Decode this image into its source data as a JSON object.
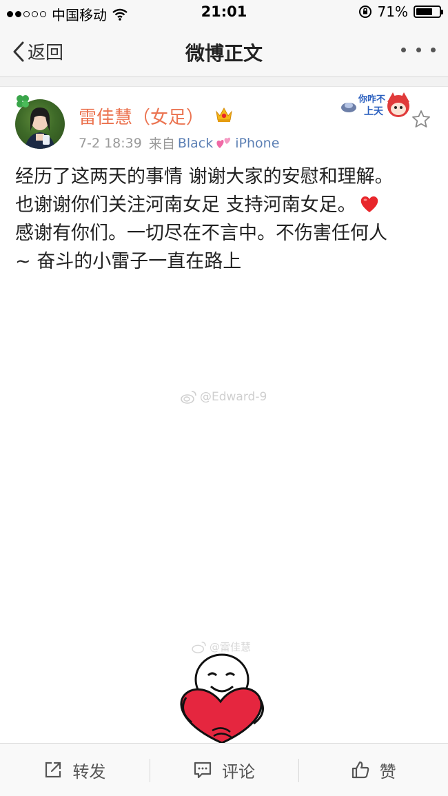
{
  "status_bar": {
    "carrier": "中国移动",
    "time": "21:01",
    "battery_percent": "71%",
    "battery_level": 0.71
  },
  "nav": {
    "back_label": "返回",
    "title": "微博正文"
  },
  "post": {
    "user_name": "雷佳慧（女足）",
    "time": "7-2 18:39",
    "source_prefix": "来自",
    "source_brand": "Black",
    "source_device": "iPhone",
    "badge_text_top": "你咋不",
    "badge_text_bottom": "上天",
    "lines": [
      "经历了这两天的事情 谢谢大家的安慰和理解。",
      "也谢谢你们关注河南女足 支持河南女足。",
      "感谢有你们。一切尽在不言中。不伤害任何人",
      "~ 奋斗的小雷子一直在路上"
    ]
  },
  "watermarks": {
    "main": "@Edward-9",
    "sticker": "@雷佳慧"
  },
  "toolbar": {
    "repost_label": "转发",
    "comment_label": "评论",
    "like_label": "赞"
  },
  "colors": {
    "username": "#eb7350",
    "source_link": "#5b7fb4",
    "heart": "#e8262b"
  }
}
